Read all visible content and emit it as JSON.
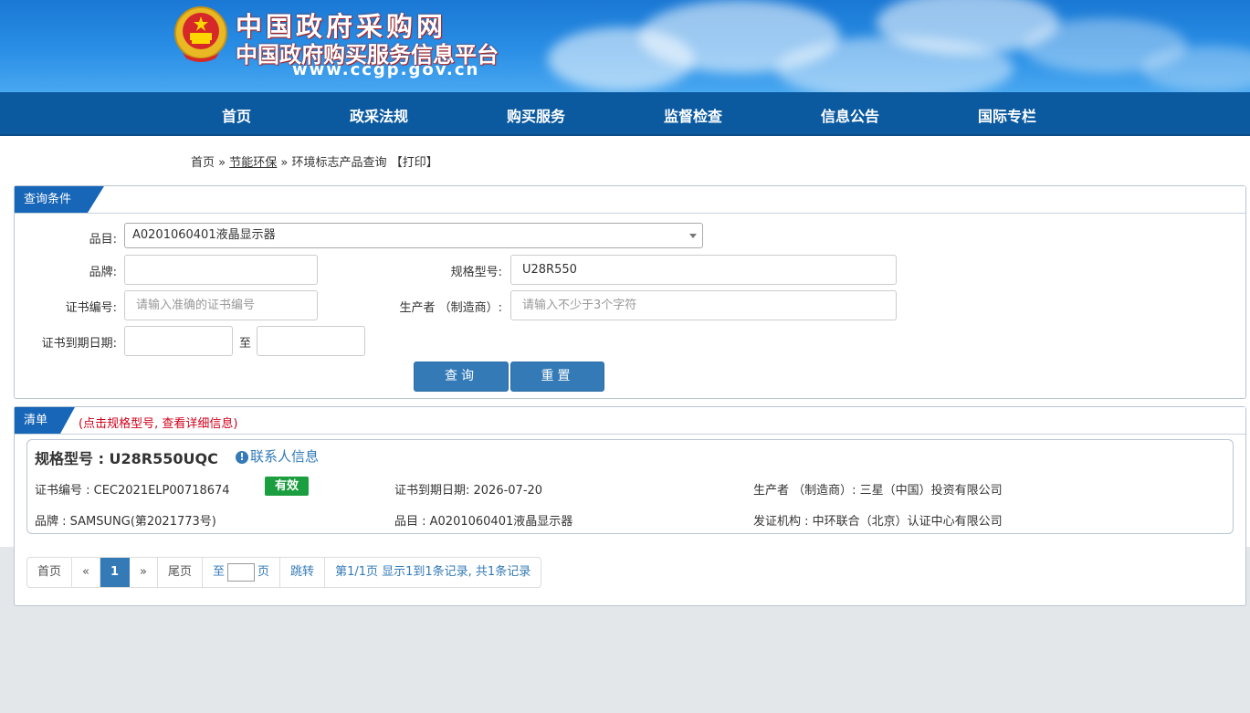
{
  "header": {
    "site_name": "中国政府采购网",
    "platform_name": "中国政府购买服务信息平台",
    "url": "www.ccgp.gov.cn"
  },
  "nav": [
    "首页",
    "政采法规",
    "购买服务",
    "监督检查",
    "信息公告",
    "国际专栏"
  ],
  "breadcrumb": {
    "home": "首页",
    "sep1": "»",
    "section": "节能环保",
    "sep2": "»",
    "current": "环境标志产品查询",
    "print": "【打印】"
  },
  "query": {
    "panel_title": "查询条件",
    "category_label": "品目:",
    "category_value": "A0201060401液晶显示器",
    "brand_label": "品牌:",
    "brand_value": "",
    "model_label": "规格型号:",
    "model_value": "U28R550",
    "cert_label": "证书编号:",
    "cert_placeholder": "请输入准确的证书编号",
    "producer_label": "生产者 （制造商）:",
    "producer_placeholder": "请输入不少于3个字符",
    "expiry_label": "证书到期日期:",
    "expiry_to": "至",
    "search_button": "查询",
    "reset_button": "重置"
  },
  "list": {
    "panel_title": "清单",
    "hint": "(点击规格型号, 查看详细信息)",
    "items": [
      {
        "title": "规格型号 : U28R550UQC",
        "contact": "联系人信息",
        "cert": "证书编号 : CEC2021ELP00718674",
        "status": "有效",
        "expiry": "证书到期日期: 2026-07-20",
        "producer": "生产者 （制造商）: 三星（中国）投资有限公司",
        "brand": "品牌 : SAMSUNG(第2021773号)",
        "category": "品目 : A0201060401液晶显示器",
        "issuer": "发证机构 : 中环联合（北京）认证中心有限公司"
      }
    ]
  },
  "pager": {
    "first": "首页",
    "prev": "«",
    "current": "1",
    "next": "»",
    "last": "尾页",
    "goto_pre": "至",
    "goto_post": "页",
    "jump": "跳转",
    "summary": "第1/1页  显示1到1条记录, 共1条记录"
  },
  "colors": {
    "accent": "#337ab7",
    "nav": "#0b5aa0",
    "valid_badge": "#1a9e3f",
    "hint": "#d0021b"
  }
}
